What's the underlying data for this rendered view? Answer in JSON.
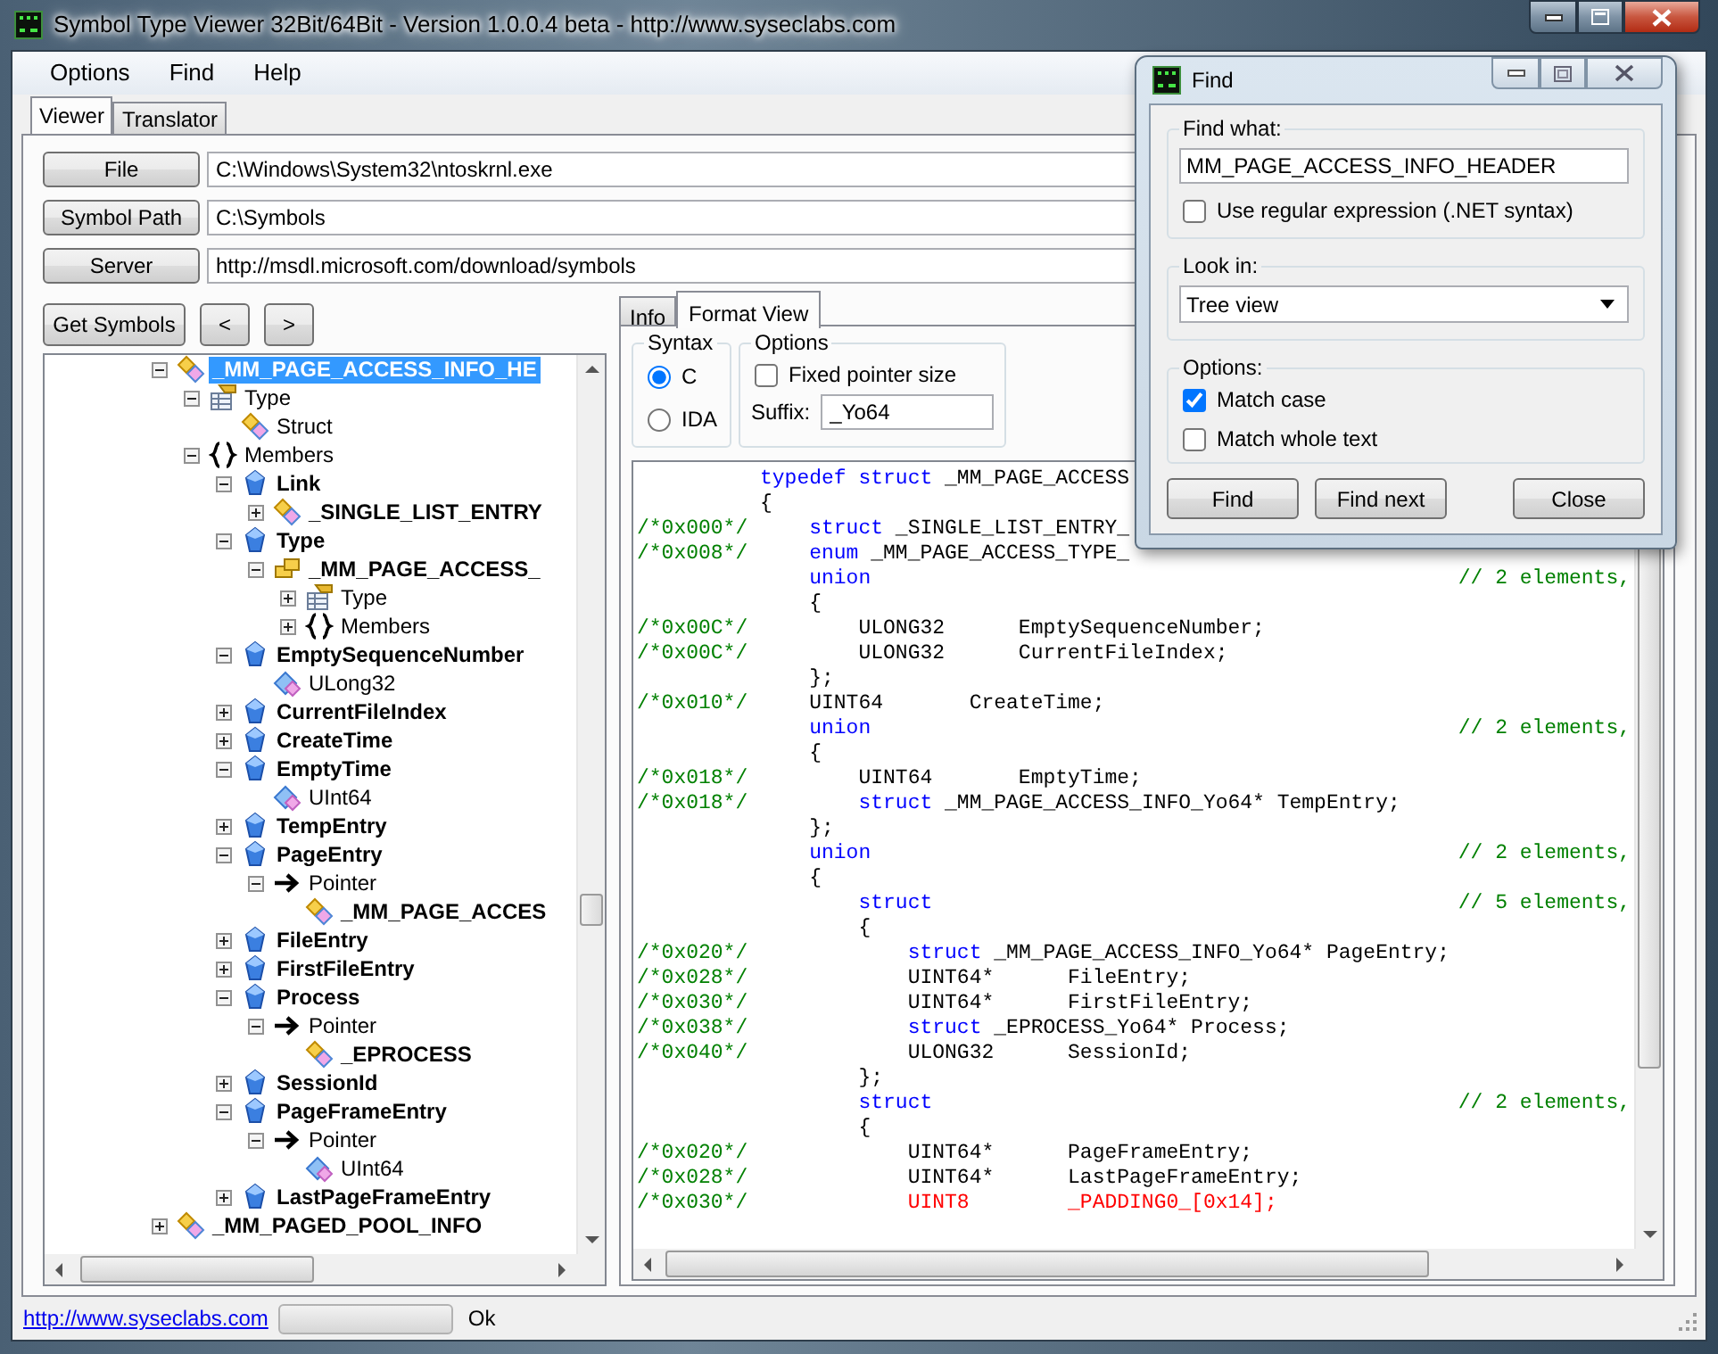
{
  "window": {
    "title": "Symbol Type Viewer 32Bit/64Bit - Version 1.0.0.4 beta - http://www.syseclabs.com"
  },
  "menu": [
    "Options",
    "Find",
    "Help"
  ],
  "tabs": [
    {
      "label": "Viewer",
      "selected": true
    },
    {
      "label": "Translator",
      "selected": false
    }
  ],
  "paths": [
    {
      "button": "File",
      "value": "C:\\Windows\\System32\\ntoskrnl.exe"
    },
    {
      "button": "Symbol Path",
      "value": "C:\\Symbols"
    },
    {
      "button": "Server",
      "value": "http://msdl.microsoft.com/download/symbols"
    }
  ],
  "toolbar": {
    "get_symbols": "Get Symbols",
    "back": "<",
    "forward": ">"
  },
  "tree": [
    {
      "label": "_MM_PAGE_ACCESS_INFO_HE",
      "kind": "struct",
      "bold": true,
      "selected": true,
      "expanded": true,
      "children": [
        {
          "label": "Type",
          "kind": "type",
          "bold": false,
          "selected": false,
          "expanded": true,
          "children": [
            {
              "label": "Struct",
              "kind": "struct",
              "bold": false,
              "selected": false
            }
          ]
        },
        {
          "label": "Members",
          "kind": "members",
          "bold": false,
          "selected": false,
          "expanded": true,
          "children": [
            {
              "label": "Link",
              "kind": "field",
              "bold": true,
              "selected": false,
              "expanded": true,
              "children": [
                {
                  "label": "_SINGLE_LIST_ENTRY",
                  "kind": "struct",
                  "bold": true,
                  "selected": false,
                  "expanded": false
                }
              ]
            },
            {
              "label": "Type",
              "kind": "field",
              "bold": true,
              "selected": false,
              "expanded": true,
              "children": [
                {
                  "label": "_MM_PAGE_ACCESS_",
                  "kind": "enum",
                  "bold": true,
                  "selected": false,
                  "expanded": true,
                  "children": [
                    {
                      "label": "Type",
                      "kind": "type",
                      "bold": false,
                      "selected": false,
                      "expanded": false
                    },
                    {
                      "label": "Members",
                      "kind": "members",
                      "bold": false,
                      "selected": false,
                      "expanded": false
                    }
                  ]
                }
              ]
            },
            {
              "label": "EmptySequenceNumber",
              "kind": "field",
              "bold": true,
              "selected": false,
              "expanded": true,
              "children": [
                {
                  "label": "ULong32",
                  "kind": "base",
                  "bold": false,
                  "selected": false
                }
              ]
            },
            {
              "label": "CurrentFileIndex",
              "kind": "field",
              "bold": true,
              "selected": false,
              "expanded": false
            },
            {
              "label": "CreateTime",
              "kind": "field",
              "bold": true,
              "selected": false,
              "expanded": false
            },
            {
              "label": "EmptyTime",
              "kind": "field",
              "bold": true,
              "selected": false,
              "expanded": true,
              "children": [
                {
                  "label": "UInt64",
                  "kind": "base",
                  "bold": false,
                  "selected": false
                }
              ]
            },
            {
              "label": "TempEntry",
              "kind": "field",
              "bold": true,
              "selected": false,
              "expanded": false
            },
            {
              "label": "PageEntry",
              "kind": "field",
              "bold": true,
              "selected": false,
              "expanded": true,
              "children": [
                {
                  "label": "Pointer",
                  "kind": "pointer",
                  "bold": false,
                  "selected": false,
                  "expanded": true,
                  "children": [
                    {
                      "label": "_MM_PAGE_ACCES",
                      "kind": "struct",
                      "bold": true,
                      "selected": false
                    }
                  ]
                }
              ]
            },
            {
              "label": "FileEntry",
              "kind": "field",
              "bold": true,
              "selected": false,
              "expanded": false
            },
            {
              "label": "FirstFileEntry",
              "kind": "field",
              "bold": true,
              "selected": false,
              "expanded": false
            },
            {
              "label": "Process",
              "kind": "field",
              "bold": true,
              "selected": false,
              "expanded": true,
              "children": [
                {
                  "label": "Pointer",
                  "kind": "pointer",
                  "bold": false,
                  "selected": false,
                  "expanded": true,
                  "children": [
                    {
                      "label": "_EPROCESS",
                      "kind": "struct",
                      "bold": true,
                      "selected": false
                    }
                  ]
                }
              ]
            },
            {
              "label": "SessionId",
              "kind": "field",
              "bold": true,
              "selected": false,
              "expanded": false
            },
            {
              "label": "PageFrameEntry",
              "kind": "field",
              "bold": true,
              "selected": false,
              "expanded": true,
              "children": [
                {
                  "label": "Pointer",
                  "kind": "pointer",
                  "bold": false,
                  "selected": false,
                  "expanded": true,
                  "children": [
                    {
                      "label": "UInt64",
                      "kind": "base",
                      "bold": false,
                      "selected": false
                    }
                  ]
                }
              ]
            },
            {
              "label": "LastPageFrameEntry",
              "kind": "field",
              "bold": true,
              "selected": false,
              "expanded": false
            }
          ]
        }
      ]
    },
    {
      "label": "_MM_PAGED_POOL_INFO",
      "kind": "struct",
      "bold": true,
      "selected": false,
      "expanded": false
    }
  ],
  "detail_tabs": [
    {
      "label": "Info",
      "selected": false
    },
    {
      "label": "Format View",
      "selected": true
    }
  ],
  "syntax": {
    "legend": "Syntax",
    "options": [
      {
        "label": "C",
        "selected": true
      },
      {
        "label": "IDA",
        "selected": false
      }
    ]
  },
  "format_options": {
    "legend": "Options",
    "fixed_pointer": {
      "label": "Fixed pointer size",
      "checked": false
    },
    "suffix_label": "Suffix:",
    "suffix": "_Yo64"
  },
  "code": [
    {
      "tokens": [
        {
          "kind": "keyword",
          "text": "typedef struct"
        },
        {
          "kind": "plain",
          "text": " _MM_PAGE_ACCESS"
        }
      ]
    },
    {
      "tokens": [
        {
          "kind": "plain",
          "text": "{"
        }
      ]
    },
    {
      "offset": "/*0x000*/",
      "tokens": [
        {
          "kind": "keyword",
          "text": "    struct"
        },
        {
          "kind": "plain",
          "text": " _SINGLE_LIST_ENTRY_"
        }
      ]
    },
    {
      "offset": "/*0x008*/",
      "tokens": [
        {
          "kind": "keyword",
          "text": "    enum"
        },
        {
          "kind": "plain",
          "text": " _MM_PAGE_ACCESS_TYPE_"
        }
      ]
    },
    {
      "tokens": [
        {
          "kind": "keyword",
          "text": "    union"
        }
      ],
      "comment": "// 2 elements,"
    },
    {
      "tokens": [
        {
          "kind": "plain",
          "text": "    {"
        }
      ]
    },
    {
      "offset": "/*0x00C*/",
      "tokens": [
        {
          "kind": "plain",
          "text": "        ULONG32      EmptySequenceNumber;"
        }
      ]
    },
    {
      "offset": "/*0x00C*/",
      "tokens": [
        {
          "kind": "plain",
          "text": "        ULONG32      CurrentFileIndex;"
        }
      ]
    },
    {
      "tokens": [
        {
          "kind": "plain",
          "text": "    };"
        }
      ]
    },
    {
      "offset": "/*0x010*/",
      "tokens": [
        {
          "kind": "plain",
          "text": "    UINT64       CreateTime;"
        }
      ]
    },
    {
      "tokens": [
        {
          "kind": "keyword",
          "text": "    union"
        }
      ],
      "comment": "// 2 elements,"
    },
    {
      "tokens": [
        {
          "kind": "plain",
          "text": "    {"
        }
      ]
    },
    {
      "offset": "/*0x018*/",
      "tokens": [
        {
          "kind": "plain",
          "text": "        UINT64       EmptyTime;"
        }
      ]
    },
    {
      "offset": "/*0x018*/",
      "tokens": [
        {
          "kind": "keyword",
          "text": "        struct"
        },
        {
          "kind": "plain",
          "text": " _MM_PAGE_ACCESS_INFO_Yo64* TempEntry;"
        }
      ]
    },
    {
      "tokens": [
        {
          "kind": "plain",
          "text": "    };"
        }
      ]
    },
    {
      "tokens": [
        {
          "kind": "keyword",
          "text": "    union"
        }
      ],
      "comment": "// 2 elements,"
    },
    {
      "tokens": [
        {
          "kind": "plain",
          "text": "    {"
        }
      ]
    },
    {
      "tokens": [
        {
          "kind": "keyword",
          "text": "        struct"
        }
      ],
      "comment": "// 5 elements,"
    },
    {
      "tokens": [
        {
          "kind": "plain",
          "text": "        {"
        }
      ]
    },
    {
      "offset": "/*0x020*/",
      "tokens": [
        {
          "kind": "keyword",
          "text": "            struct"
        },
        {
          "kind": "plain",
          "text": " _MM_PAGE_ACCESS_INFO_Yo64* PageEntry;"
        }
      ]
    },
    {
      "offset": "/*0x028*/",
      "tokens": [
        {
          "kind": "plain",
          "text": "            UINT64*      FileEntry;"
        }
      ]
    },
    {
      "offset": "/*0x030*/",
      "tokens": [
        {
          "kind": "plain",
          "text": "            UINT64*      FirstFileEntry;"
        }
      ]
    },
    {
      "offset": "/*0x038*/",
      "tokens": [
        {
          "kind": "keyword",
          "text": "            struct"
        },
        {
          "kind": "plain",
          "text": " _EPROCESS_Yo64* Process;"
        }
      ]
    },
    {
      "offset": "/*0x040*/",
      "tokens": [
        {
          "kind": "plain",
          "text": "            ULONG32      SessionId;"
        }
      ]
    },
    {
      "tokens": [
        {
          "kind": "plain",
          "text": "        };"
        }
      ]
    },
    {
      "tokens": [
        {
          "kind": "keyword",
          "text": "        struct"
        }
      ],
      "comment": "// 2 elements,"
    },
    {
      "tokens": [
        {
          "kind": "plain",
          "text": "        {"
        }
      ]
    },
    {
      "offset": "/*0x020*/",
      "tokens": [
        {
          "kind": "plain",
          "text": "            UINT64*      PageFrameEntry;"
        }
      ]
    },
    {
      "offset": "/*0x028*/",
      "tokens": [
        {
          "kind": "plain",
          "text": "            UINT64*      LastPageFrameEntry;"
        }
      ]
    },
    {
      "offset": "/*0x030*/",
      "tokens": [
        {
          "kind": "error",
          "text": "            UINT8        _PADDING0_[0x14];"
        }
      ]
    }
  ],
  "find_dialog": {
    "title": "Find",
    "find_what": {
      "legend": "Find what:",
      "value": "MM_PAGE_ACCESS_INFO_HEADER",
      "regex": {
        "label": "Use regular expression (.NET syntax)",
        "checked": false
      }
    },
    "look_in": {
      "legend": "Look in:",
      "value": "Tree view"
    },
    "options": {
      "legend": "Options:",
      "items": [
        {
          "label": "Match case",
          "checked": true
        },
        {
          "label": "Match whole text",
          "checked": false
        }
      ]
    },
    "buttons": [
      "Find",
      "Find next",
      "Close"
    ]
  },
  "status_bar": {
    "link": "http://www.syseclabs.com",
    "progress": {
      "level": 0
    },
    "text": "Ok"
  }
}
